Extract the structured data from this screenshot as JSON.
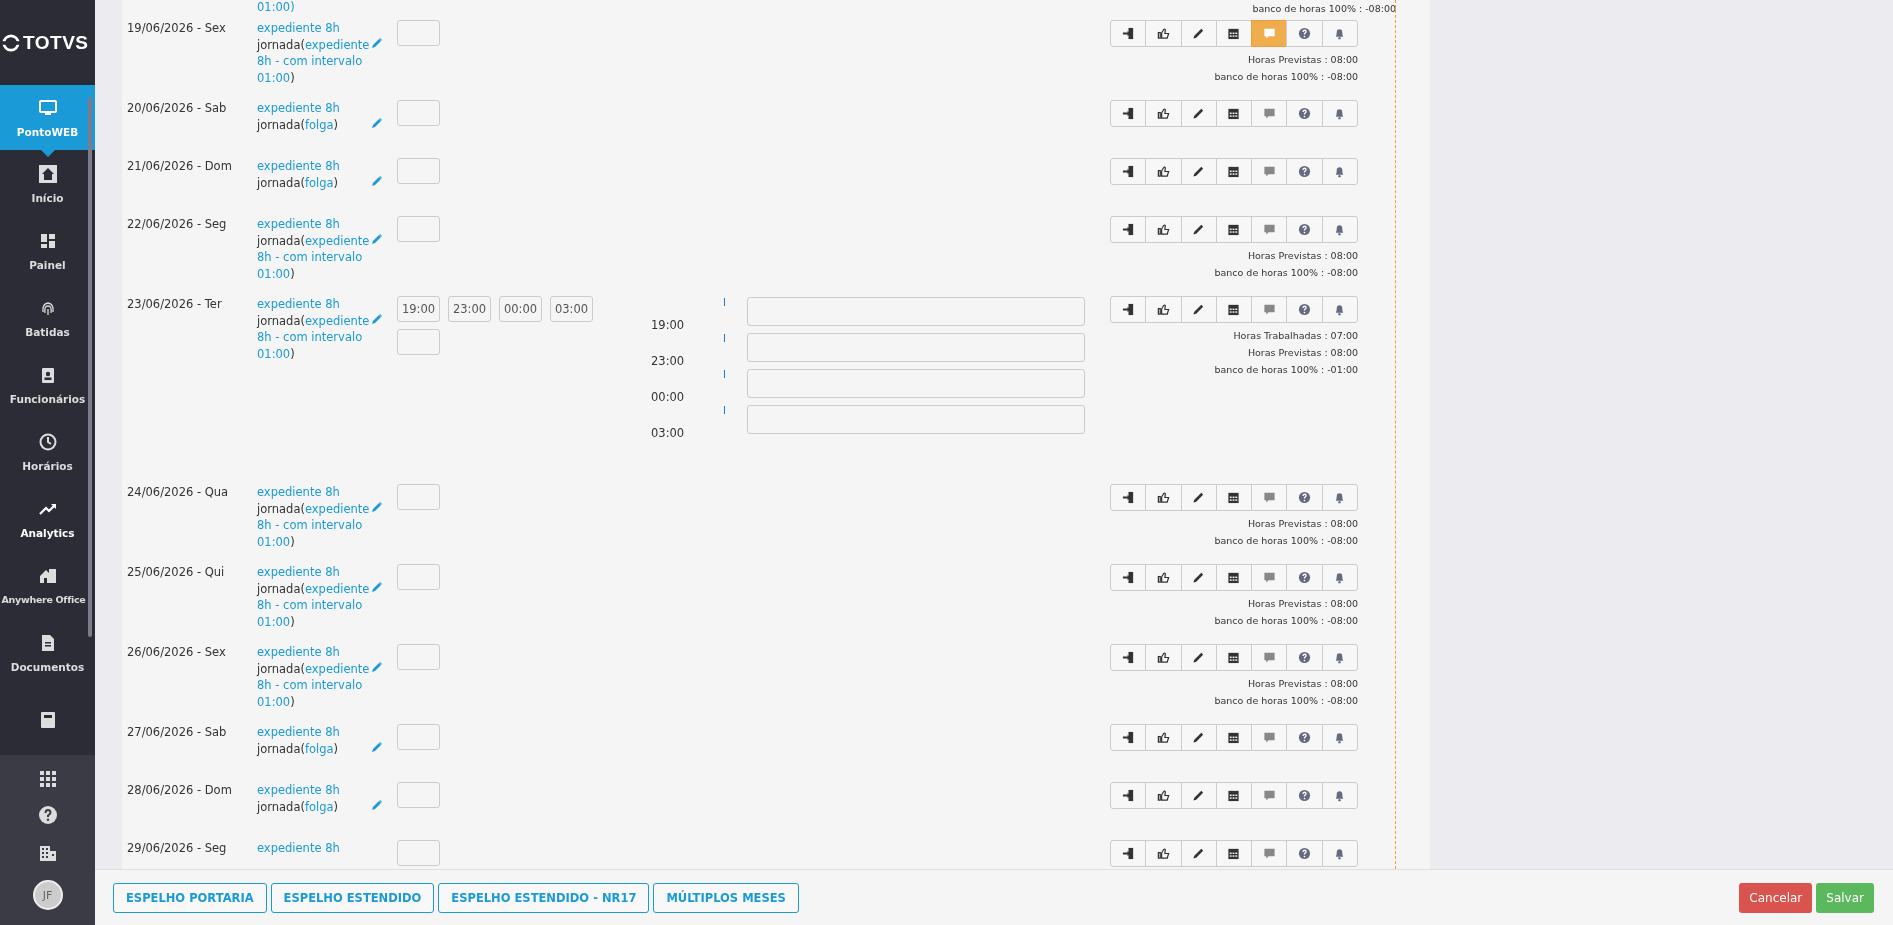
{
  "sidebar": {
    "logo": "TOTVS",
    "items": [
      {
        "label": "PontoWEB",
        "selected": true,
        "highlighted": false
      },
      {
        "label": "Início",
        "selected": false,
        "highlighted": false
      },
      {
        "label": "Painel",
        "selected": false,
        "highlighted": false
      },
      {
        "label": "Batidas",
        "selected": false,
        "highlighted": false
      },
      {
        "label": "Funcionários",
        "selected": false,
        "highlighted": false
      },
      {
        "label": "Horários",
        "selected": false,
        "highlighted": false
      },
      {
        "label": "Analytics",
        "selected": false,
        "highlighted": true
      },
      {
        "label": "Anywhere Office",
        "selected": false,
        "highlighted": false
      },
      {
        "label": "Documentos",
        "selected": false,
        "highlighted": false
      }
    ],
    "avatar": "JF"
  },
  "top_fragment": {
    "schedule": "01:00)",
    "info": "banco de horas 100% : -08:00"
  },
  "rows": [
    {
      "date": "19/06/2026 - Sex",
      "schedule": "expediente 8h",
      "jornada": "jornada(",
      "jornada_link": "expediente 8h - com intervalo 01:00",
      "close": ")",
      "punches": [],
      "details": [],
      "comment_active": true,
      "info": [
        "Horas Previstas : 08:00",
        "banco de horas 100% : -08:00"
      ]
    },
    {
      "date": "20/06/2026 - Sab",
      "schedule": "expediente 8h",
      "jornada": "jornada(",
      "jornada_link": "folga",
      "close": ")",
      "punches": [],
      "details": [],
      "comment_active": false,
      "info": []
    },
    {
      "date": "21/06/2026 - Dom",
      "schedule": "expediente 8h",
      "jornada": "jornada(",
      "jornada_link": "folga",
      "close": ")",
      "punches": [],
      "details": [],
      "comment_active": false,
      "info": []
    },
    {
      "date": "22/06/2026 - Seg",
      "schedule": "expediente 8h",
      "jornada": "jornada(",
      "jornada_link": "expediente 8h - com intervalo 01:00",
      "close": ")",
      "punches": [],
      "details": [],
      "comment_active": false,
      "info": [
        "Horas Previstas : 08:00",
        "banco de horas 100% : -08:00"
      ]
    },
    {
      "date": "23/06/2026 - Ter",
      "schedule": "expediente 8h",
      "jornada": "jornada(",
      "jornada_link": "expediente 8h - com intervalo 01:00",
      "close": ")",
      "punches": [
        "19:00",
        "23:00",
        "00:00",
        "03:00"
      ],
      "details": [
        {
          "time": "19:00",
          "marker": "I"
        },
        {
          "time": "23:00",
          "marker": "I"
        },
        {
          "time": "00:00",
          "marker": "I"
        },
        {
          "time": "03:00",
          "marker": "I"
        }
      ],
      "comment_active": false,
      "info": [
        "Horas Trabalhadas : 07:00",
        "Horas Previstas : 08:00",
        "banco de horas 100% : -01:00"
      ]
    },
    {
      "date": "24/06/2026 - Qua",
      "schedule": "expediente 8h",
      "jornada": "jornada(",
      "jornada_link": "expediente 8h - com intervalo 01:00",
      "close": ")",
      "punches": [],
      "details": [],
      "comment_active": false,
      "info": [
        "Horas Previstas : 08:00",
        "banco de horas 100% : -08:00"
      ]
    },
    {
      "date": "25/06/2026 - Qui",
      "schedule": "expediente 8h",
      "jornada": "jornada(",
      "jornada_link": "expediente 8h - com intervalo 01:00",
      "close": ")",
      "punches": [],
      "details": [],
      "comment_active": false,
      "info": [
        "Horas Previstas : 08:00",
        "banco de horas 100% : -08:00"
      ]
    },
    {
      "date": "26/06/2026 - Sex",
      "schedule": "expediente 8h",
      "jornada": "jornada(",
      "jornada_link": "expediente 8h - com intervalo 01:00",
      "close": ")",
      "punches": [],
      "details": [],
      "comment_active": false,
      "info": [
        "Horas Previstas : 08:00",
        "banco de horas 100% : -08:00"
      ]
    },
    {
      "date": "27/06/2026 - Sab",
      "schedule": "expediente 8h",
      "jornada": "jornada(",
      "jornada_link": "folga",
      "close": ")",
      "punches": [],
      "details": [],
      "comment_active": false,
      "info": []
    },
    {
      "date": "28/06/2026 - Dom",
      "schedule": "expediente 8h",
      "jornada": "jornada(",
      "jornada_link": "folga",
      "close": ")",
      "punches": [],
      "details": [],
      "comment_active": false,
      "info": []
    },
    {
      "date": "29/06/2026 - Seg",
      "schedule": "expediente 8h",
      "punches": [],
      "details": [],
      "comment_active": false,
      "info": []
    }
  ],
  "footer": {
    "reports": [
      "ESPELHO PORTARIA",
      "ESPELHO ESTENDIDO",
      "ESPELHO ESTENDIDO - NR17",
      "MÚLTIPLOS MESES"
    ],
    "cancel": "Cancelar",
    "save": "Salvar"
  }
}
